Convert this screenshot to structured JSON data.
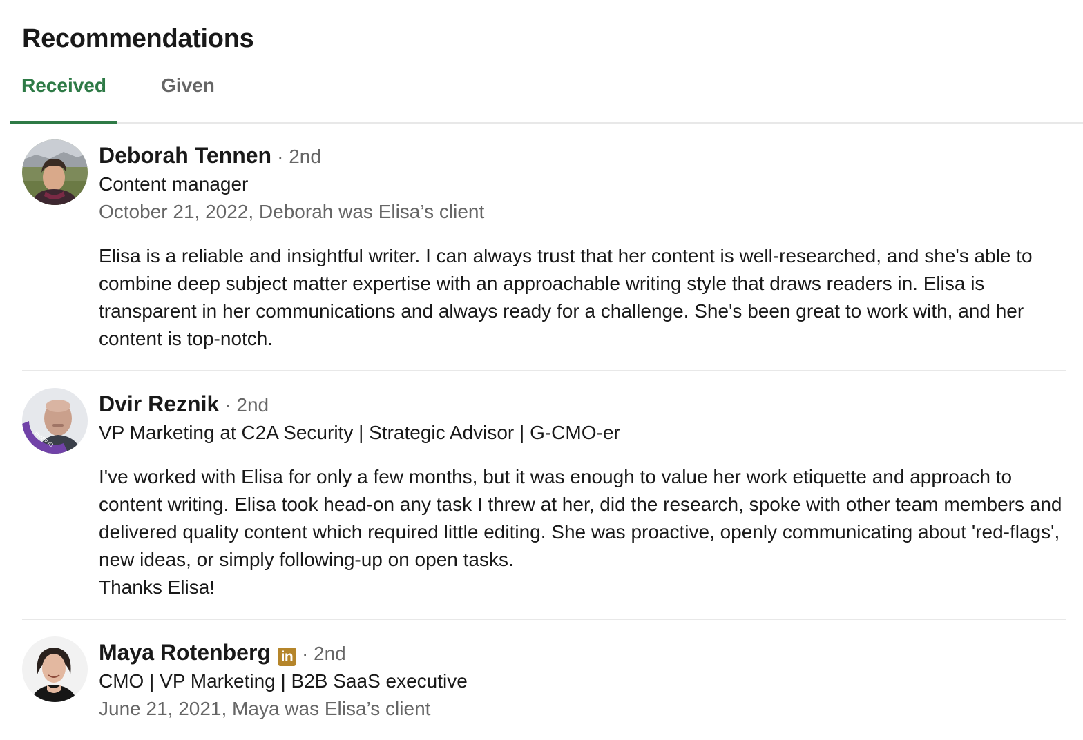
{
  "section": {
    "title": "Recommendations"
  },
  "tabs": [
    {
      "label": "Received",
      "active": true
    },
    {
      "label": "Given",
      "active": false
    }
  ],
  "colors": {
    "accent": "#2e7a46",
    "muted_text": "#666666",
    "divider": "#e8e8e8",
    "badge": "#b5852a"
  },
  "recommendations": [
    {
      "name": "Deborah Tennen",
      "degree": "· 2nd",
      "headline": "Content manager",
      "date": "October 21, 2022, Deborah was Elisa’s client",
      "text": "Elisa is a reliable and insightful writer. I can always trust that her content is well-researched, and she's able to combine deep subject matter expertise with an approachable writing style that draws readers in. Elisa is transparent in her communications and always ready for a challenge. She's been great to work with, and her content is top-notch."
    },
    {
      "name": "Dvir Reznik",
      "degree": "· 2nd",
      "headline": "VP Marketing at C2A Security | Strategic Advisor | G-CMO-er",
      "avatar_frame": "#HIRING",
      "text": "I've worked with Elisa for only a few months, but it was enough to value her work etiquette and approach to content writing. Elisa took head-on any task I threw at her, did the research, spoke with other team members and delivered quality content which required little editing. She was proactive, openly communicating about 'red-flags', new ideas, or simply following-up on open tasks.\nThanks Elisa!"
    },
    {
      "name": "Maya Rotenberg",
      "badge": "in",
      "degree": "· 2nd",
      "headline": "CMO | VP Marketing | B2B SaaS executive",
      "date": "June 21, 2021, Maya was Elisa’s client"
    }
  ]
}
